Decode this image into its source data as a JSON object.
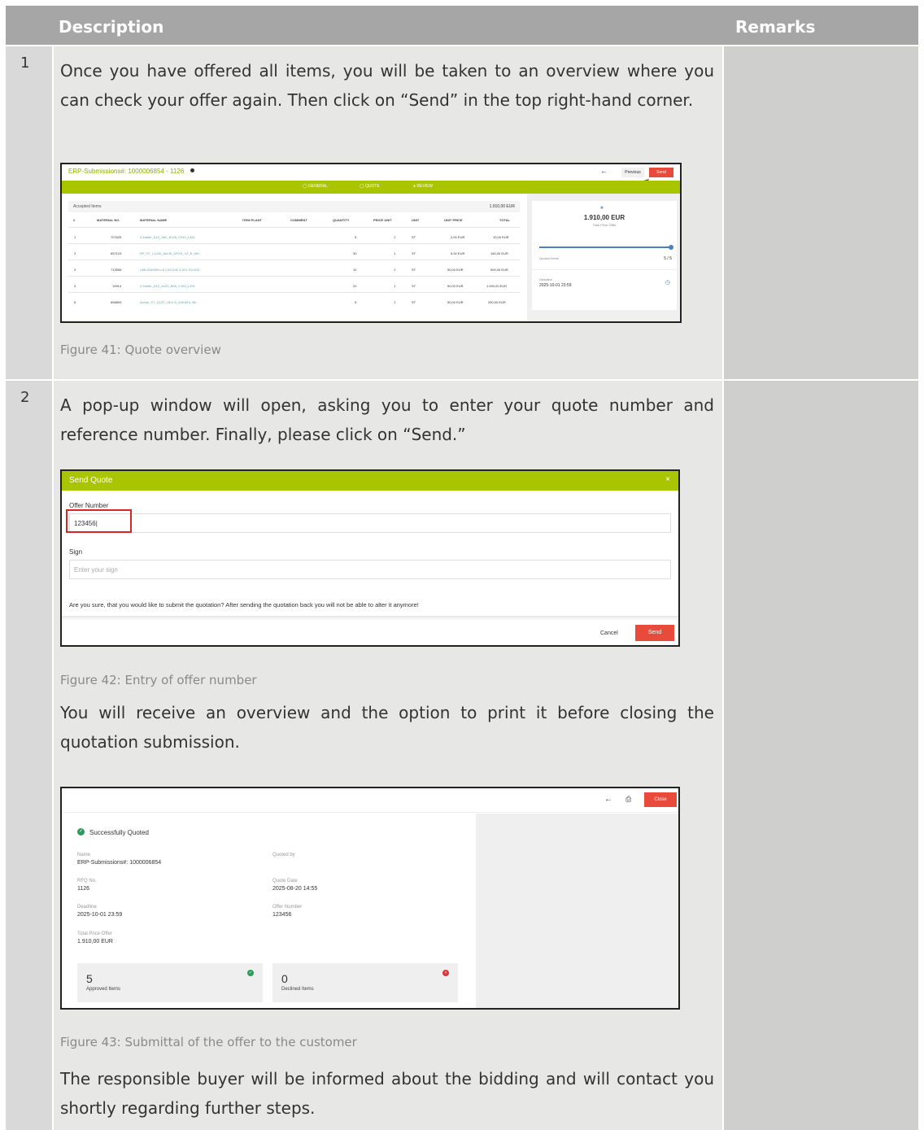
{
  "header": {
    "description": "Description",
    "remarks": "Remarks"
  },
  "rows": [
    {
      "num": "1",
      "text": "Once you have offered all items, you will be taken to an overview where you can check your offer again. Then click on “Send” in the top right-hand corner.",
      "caption": "Figure 41: Quote overview"
    },
    {
      "num": "2",
      "text": "A pop-up window will open, asking you to enter your quote number and reference number. Finally, please click on “Send.”",
      "caption": "Figure 42: Entry of offer number",
      "text2": "You will receive an overview and the option to print it before closing the quotation submission.",
      "caption2": "Figure 43: Submittal of the offer to the customer",
      "text3": "The responsible buyer will be informed about the bidding and will contact you shortly regarding further steps."
    }
  ],
  "fig41": {
    "title": "ERP-Submissions#: 1000006854 - 1126",
    "steps": [
      "GENERAL",
      "QUOTE",
      "REVIEW"
    ],
    "previous": "Previous",
    "send": "Send",
    "accepted": "Accepted Items",
    "accepted_total": "1.910,00 EUR",
    "columns": [
      "#",
      "MATERIAL NO.",
      "MATERIAL NAME",
      "ITEM PLANT",
      "COMMENT",
      "QUANTITY",
      "PRICE UNIT",
      "UNIT",
      "UNIT PRICE",
      "TOTAL"
    ],
    "items": [
      {
        "n": "1",
        "mat": "707625",
        "name": "Z-Halter_D12_A80_B195_C240_L481",
        "qty": "5",
        "pu": "1",
        "unit": "ST",
        "price": "2,00 EUR",
        "total": "10,00 EUR"
      },
      {
        "n": "2",
        "mat": "657123",
        "name": "RP_ST_L1230_AnhSt_DFXS_VZ_B_MH",
        "qty": "30",
        "pu": "1",
        "unit": "ST",
        "price": "5,00 EUR",
        "total": "150,00 EUR"
      },
      {
        "n": "3",
        "mat": "713955",
        "name": "UMLENKWELLE C45 D40 X 622 SV-600",
        "qty": "10",
        "pu": "1",
        "unit": "ST",
        "price": "50,00 EUR",
        "total": "500,00 EUR"
      },
      {
        "n": "4",
        "mat": "19914",
        "name": "Z-Halter_D12_A100_B65_C160_L291",
        "qty": "20",
        "pu": "1",
        "unit": "ST",
        "price": "50,00 EUR",
        "total": "1.000,00 EUR"
      },
      {
        "n": "5",
        "mat": "658893",
        "name": "Achse_ST_D107_L812,5_2x50M 6_BK",
        "qty": "5",
        "pu": "1",
        "unit": "ST",
        "price": "50,00 EUR",
        "total": "250,00 EUR"
      }
    ],
    "side_total": "1.910,00 EUR",
    "side_total_label": "Total Price Offer",
    "progress": 1.0,
    "quoted_label": "Quoted Items",
    "quoted_value": "5 / 5",
    "deadline_label": "Deadline",
    "deadline": "2025-10-01 23:59"
  },
  "fig42": {
    "title": "Send Quote",
    "offer_label": "Offer Number",
    "offer_value": "123456",
    "sign_label": "Sign",
    "sign_placeholder": "Enter your sign",
    "confirm": "Are you sure, that you would like to submit the quotation? After sending the quotation back you will not be able to alter it anymore!",
    "cancel": "Cancel",
    "send": "Send"
  },
  "fig43": {
    "close": "Close",
    "status": "Successfully Quoted",
    "name_label": "Name",
    "name": "ERP-Submissions#: 1000006854",
    "quoted_by_label": "Quoted by",
    "rfq_label": "RFQ No.",
    "rfq": "1126",
    "quote_date_label": "Quote Date",
    "quote_date": "2025-08-20 14:55",
    "deadline_label": "Deadline",
    "deadline": "2025-10-01 23:59",
    "offer_label": "Offer Number",
    "offer": "123456",
    "total_label": "Total Price Offer",
    "total": "1.910,00 EUR",
    "approved_count": "5",
    "approved_label": "Approved Items",
    "declined_count": "0",
    "declined_label": "Declined Items"
  },
  "colors": {
    "accent_green": "#a8c500",
    "send_red": "#e84a3c",
    "ok_green": "#2e9a5a",
    "declined_red": "#d9373c"
  }
}
